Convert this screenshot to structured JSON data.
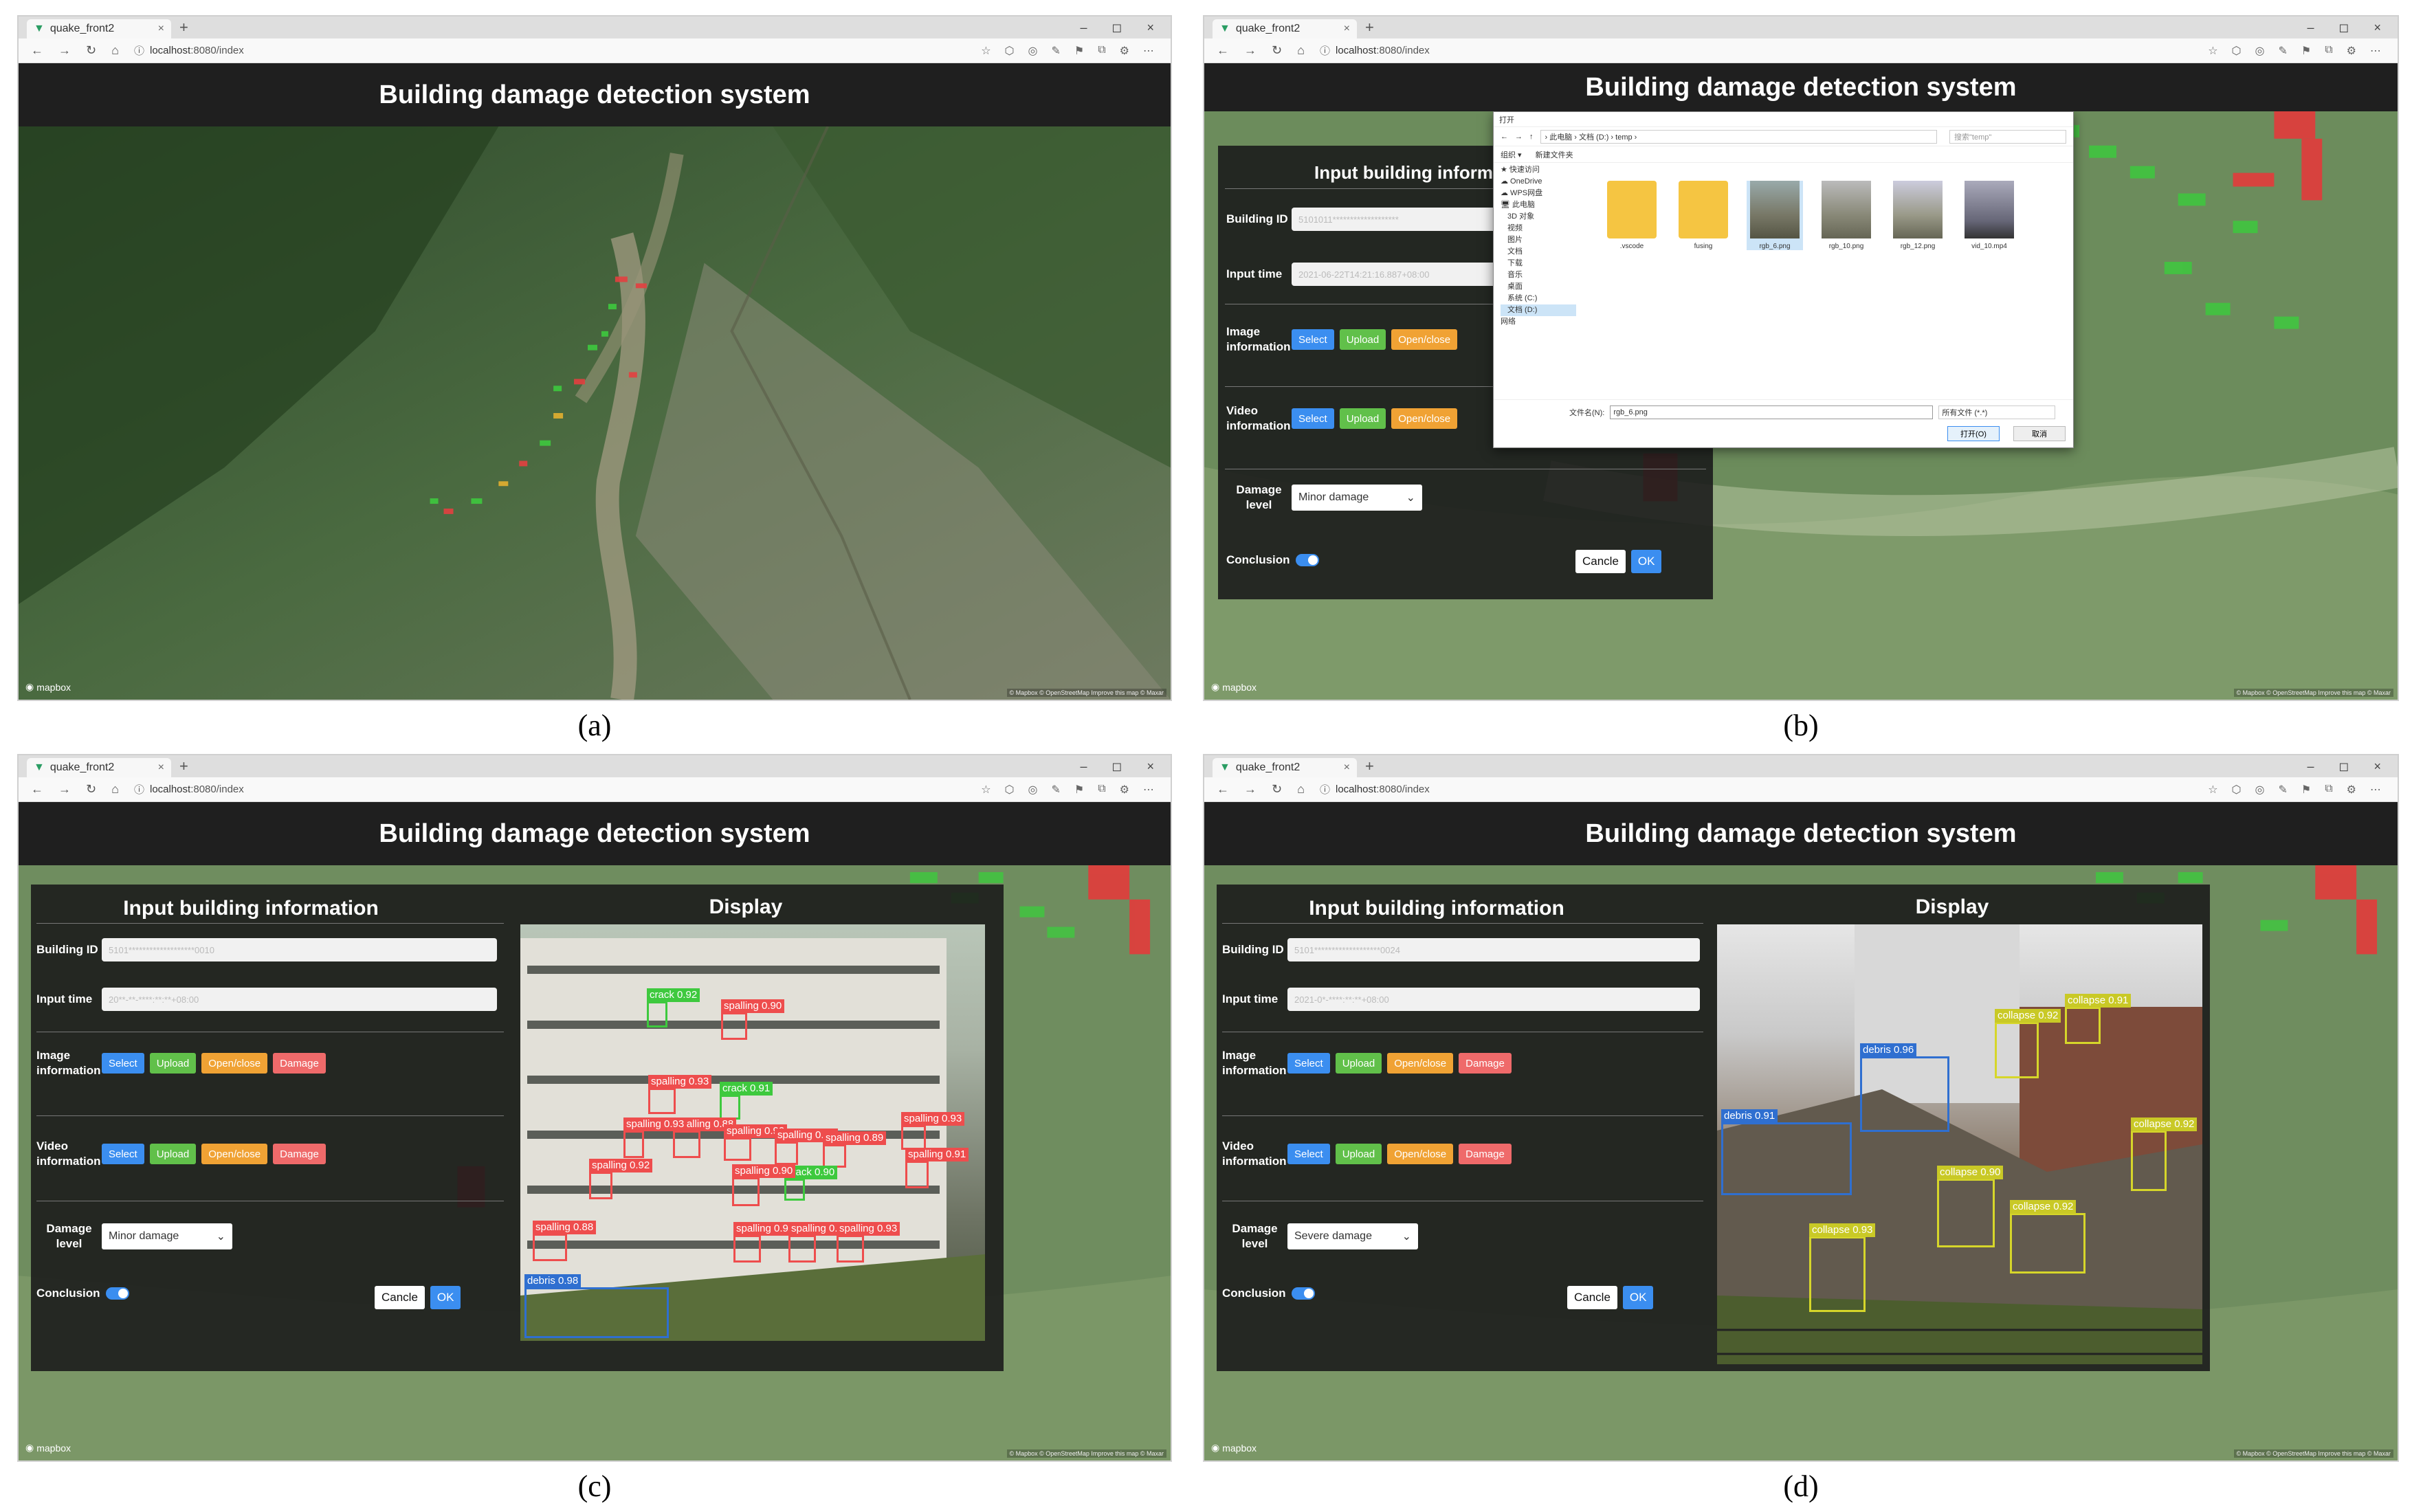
{
  "browser": {
    "tab_title": "quake_front2",
    "tab_close": "×",
    "new_tab": "+",
    "window_controls": [
      "–",
      "◻",
      "×"
    ],
    "nav_icons": [
      "←",
      "→",
      "↻",
      "⌂"
    ],
    "url_host": "localhost",
    "url_rest": ":8080/index",
    "tool_icons": [
      "☆",
      "⬡",
      "◎",
      "✎",
      "⚑",
      "⧉",
      "⚙",
      "⋯"
    ]
  },
  "app": {
    "title": "Building damage detection system",
    "map_attribution_logo": "mapbox",
    "map_attribution": "© Mapbox © OpenStreetMap Improve this map © Maxar"
  },
  "captions": [
    "(a)",
    "(b)",
    "(c)",
    "(d)"
  ],
  "form": {
    "panel_title": "Input building information",
    "display_title": "Display",
    "building_id_label": "Building ID",
    "input_time_label": "Input time",
    "image_label": "Image information",
    "video_label": "Video information",
    "damage_level_label": "Damage level",
    "conclusion_label": "Conclusion",
    "btn_select": "Select",
    "btn_upload": "Upload",
    "btn_openclose": "Open/close",
    "btn_damage": "Damage",
    "btn_cancel": "Cancle",
    "btn_ok": "OK",
    "building_id_value_b": "5101011*******************",
    "building_id_value_c": "5101*******************0010",
    "building_id_value_d": "5101*******************0024",
    "input_time_value_b": "2021-06-22T14:21:16.887+08:00",
    "input_time_value_c": "20**-**-****:**:**+08:00",
    "input_time_value_d": "2021-0*-****:**:**+08:00",
    "damage_b": "Minor damage",
    "damage_c": "Minor damage",
    "damage_d": "Severe damage",
    "chevron": "⌄"
  },
  "file_dialog": {
    "title": "打开",
    "path": "› 此电脑 › 文档 (D:) › temp ›",
    "search_placeholder": "搜索\"temp\"",
    "toolbar": [
      "组织 ▾",
      "新建文件夹"
    ],
    "sidebar": [
      "★ 快速访问",
      "☁ OneDrive",
      "☁ WPS网盘",
      "🖥 此电脑",
      "3D 对象",
      "视频",
      "图片",
      "文档",
      "下载",
      "音乐",
      "桌面",
      "系统 (C:)",
      "文档 (D:)",
      "网络"
    ],
    "files": [
      {
        "name": ".vscode",
        "kind": "folder"
      },
      {
        "name": "fusing",
        "kind": "folder"
      },
      {
        "name": "rgb_6.png",
        "kind": "image"
      },
      {
        "name": "rgb_10.png",
        "kind": "image"
      },
      {
        "name": "rgb_12.png",
        "kind": "image"
      },
      {
        "name": "vid_10.mp4",
        "kind": "video"
      }
    ],
    "filename_label": "文件名(N):",
    "filename_value": "rgb_6.png",
    "filter_value": "所有文件 (*.*)",
    "open_btn": "打开(O)",
    "cancel_btn": "取消"
  },
  "detections_c": [
    {
      "label": "crack 0.92",
      "color": "#3ec93e"
    },
    {
      "label": "spalling 0.90",
      "color": "#ee4d4d"
    },
    {
      "label": "spalling 0.93",
      "color": "#ee4d4d"
    },
    {
      "label": "crack 0.91",
      "color": "#3ec93e"
    },
    {
      "label": "spalling 0.88",
      "color": "#ee4d4d"
    },
    {
      "label": "spalling 0.93",
      "color": "#ee4d4d"
    },
    {
      "label": "spalling 0.90",
      "color": "#ee4d4d"
    },
    {
      "label": "spalling 0.90",
      "color": "#ee4d4d"
    },
    {
      "label": "spalling 0.89",
      "color": "#ee4d4d"
    },
    {
      "label": "spalling 0.91",
      "color": "#ee4d4d"
    },
    {
      "label": "spalling 0.93",
      "color": "#ee4d4d"
    },
    {
      "label": "spalling 0.92",
      "color": "#ee4d4d"
    },
    {
      "label": "crack 0.90",
      "color": "#3ec93e"
    },
    {
      "label": "spalling 0.88",
      "color": "#ee4d4d"
    },
    {
      "label": "spalling 0.90",
      "color": "#ee4d4d"
    },
    {
      "label": "spalling 0.92",
      "color": "#ee4d4d"
    },
    {
      "label": "spalling 0.92",
      "color": "#ee4d4d"
    },
    {
      "label": "spalling 0.93",
      "color": "#ee4d4d"
    },
    {
      "label": "debris 0.98",
      "color": "#2f6fd0"
    }
  ],
  "detections_d": [
    {
      "label": "debris 0.96",
      "color": "#2f6fd0"
    },
    {
      "label": "debris 0.91",
      "color": "#2f6fd0"
    },
    {
      "label": "collapse 0.92",
      "color": "#d6d62a"
    },
    {
      "label": "collapse 0.91",
      "color": "#d6d62a"
    },
    {
      "label": "collapse 0.92",
      "color": "#d6d62a"
    },
    {
      "label": "collapse 0.90",
      "color": "#d6d62a"
    },
    {
      "label": "collapse 0.92",
      "color": "#d6d62a"
    },
    {
      "label": "collapse 0.93",
      "color": "#d6d62a"
    }
  ]
}
